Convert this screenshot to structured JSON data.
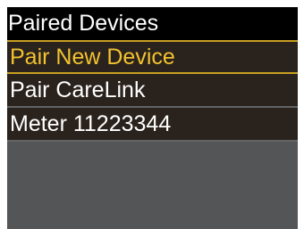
{
  "header": {
    "title": "Paired Devices"
  },
  "menu": {
    "items": [
      {
        "label": "Pair New Device",
        "selected": true
      },
      {
        "label": "Pair CareLink",
        "selected": false
      },
      {
        "label": "Meter 11223344",
        "selected": false
      }
    ]
  },
  "colors": {
    "background": "#545556",
    "title_bar": "#000000",
    "item_background": "#2a221c",
    "text": "#ffffff",
    "selected_text": "#f2c230",
    "selected_border": "#c9a021"
  }
}
